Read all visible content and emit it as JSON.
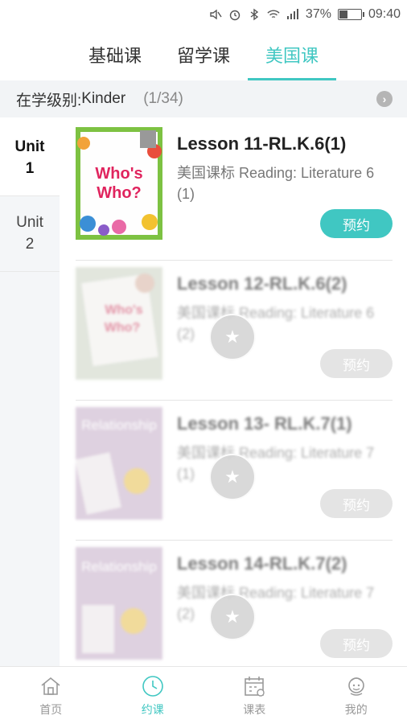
{
  "status_bar": {
    "battery": "37%",
    "time": "09:40",
    "battery_fill": 0.37
  },
  "tabs": [
    {
      "label": "基础课",
      "active": false
    },
    {
      "label": "留学课",
      "active": false
    },
    {
      "label": "美国课",
      "active": true
    }
  ],
  "level": {
    "label": "在学级别:",
    "value": "Kinder",
    "count": "(1/34)"
  },
  "units": [
    {
      "line1": "Unit",
      "line2": "1",
      "active": true
    },
    {
      "line1": "Unit",
      "line2": "2",
      "active": false
    }
  ],
  "lessons": [
    {
      "title": "Lesson 11-RL.K.6(1)",
      "desc": "美国课标 Reading: Literature 6 (1)",
      "button": "预约",
      "locked": false,
      "thumb_text_1": "Who's",
      "thumb_text_2": "Who?"
    },
    {
      "title": "Lesson 12-RL.K.6(2)",
      "desc": "美国课标 Reading: Literature 6 (2)",
      "button": "预约",
      "locked": true,
      "thumb_text_1": "Who's",
      "thumb_text_2": "Who?"
    },
    {
      "title": "Lesson 13- RL.K.7(1)",
      "desc": "美国课标 Reading: Literature 7 (1)",
      "button": "预约",
      "locked": true,
      "thumb_text_1": "Relationship"
    },
    {
      "title": "Lesson 14-RL.K.7(2)",
      "desc": "美国课标 Reading: Literature 7 (2)",
      "button": "预约",
      "locked": true,
      "thumb_text_1": "Relationship"
    }
  ],
  "bottom_nav": [
    {
      "label": "首页",
      "icon": "home-icon",
      "active": false
    },
    {
      "label": "约课",
      "icon": "clock-icon",
      "active": true
    },
    {
      "label": "课表",
      "icon": "calendar-icon",
      "active": false
    },
    {
      "label": "我的",
      "icon": "profile-icon",
      "active": false
    }
  ],
  "colors": {
    "accent": "#40c7c2",
    "disabled": "#e4e4e4"
  }
}
